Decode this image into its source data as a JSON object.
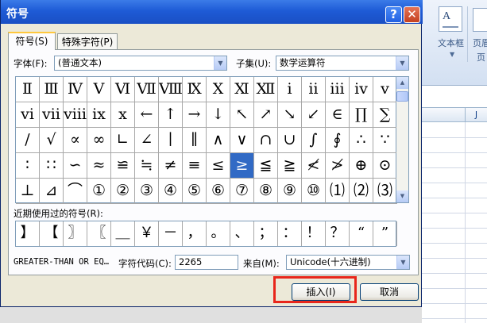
{
  "dialog": {
    "title": "符号",
    "help_button": "?",
    "close_button": "✕",
    "tabs": [
      {
        "label": "符号(S)",
        "active": true
      },
      {
        "label": "特殊字符(P)",
        "active": false
      }
    ],
    "font_label": "字体(F):",
    "font_value": "(普通文本)",
    "subset_label": "子集(U):",
    "subset_value": "数学运算符",
    "symbol_rows": [
      [
        "Ⅱ",
        "Ⅲ",
        "Ⅳ",
        "Ⅴ",
        "Ⅵ",
        "Ⅶ",
        "Ⅷ",
        "Ⅸ",
        "Ⅹ",
        "Ⅺ",
        "Ⅻ",
        "ⅰ",
        "ⅱ",
        "ⅲ",
        "ⅳ",
        "ⅴ"
      ],
      [
        "ⅵ",
        "ⅶ",
        "ⅷ",
        "ⅸ",
        "ⅹ",
        "←",
        "↑",
        "→",
        "↓",
        "↖",
        "↗",
        "↘",
        "↙",
        "∈",
        "∏",
        "∑"
      ],
      [
        "∕",
        "√",
        "∝",
        "∞",
        "∟",
        "∠",
        "∣",
        "∥",
        "∧",
        "∨",
        "∩",
        "∪",
        "∫",
        "∮",
        "∴",
        "∵"
      ],
      [
        "∶",
        "∷",
        "∽",
        "≈",
        "≌",
        "≒",
        "≠",
        "≡",
        "≤",
        "≥",
        "≦",
        "≧",
        "≮",
        "≯",
        "⊕",
        "⊙"
      ],
      [
        "⊥",
        "⊿",
        "⌒",
        "①",
        "②",
        "③",
        "④",
        "⑤",
        "⑥",
        "⑦",
        "⑧",
        "⑨",
        "⑩",
        "⑴",
        "⑵",
        "⑶"
      ]
    ],
    "selected_symbol": "≥",
    "recent_label": "近期使用过的符号(R):",
    "recent_symbols": [
      "】",
      "【",
      "〗",
      "〖",
      "＿",
      "￥",
      "－",
      "，",
      "。",
      "、",
      "；",
      "：",
      "！",
      "？",
      "“",
      "”"
    ],
    "char_name": "GREATER-THAN OR EQ…",
    "char_code_label": "字符代码(C):",
    "char_code_value": "2265",
    "from_label": "来自(M):",
    "from_value": "Unicode(十六进制)",
    "insert_button": "插入(I)",
    "cancel_button": "取消"
  },
  "background": {
    "textbox_label": "文本框",
    "header_label_1": "页眉",
    "header_label_2": "页",
    "column_label": "J"
  },
  "colors": {
    "selection": "#316ac5",
    "highlight": "#e8261b",
    "titlebar": "#1e5bd6"
  }
}
